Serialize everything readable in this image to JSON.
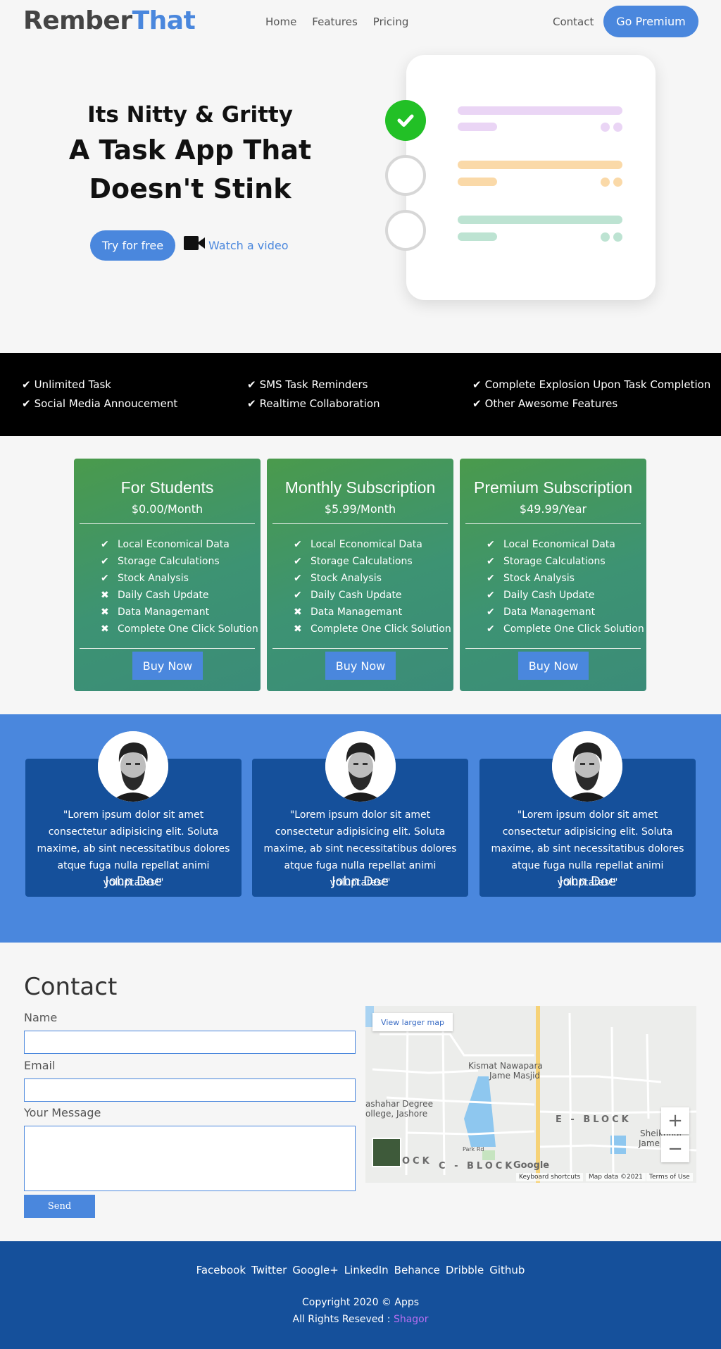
{
  "brand": {
    "part1": "Rember",
    "part2": "That",
    "accent": "#4a87dd"
  },
  "nav": {
    "links": [
      "Home",
      "Features",
      "Pricing"
    ],
    "contact": "Contact",
    "premium_button": "Go Premium"
  },
  "hero": {
    "subtitle": "Its Nitty & Gritty",
    "title_line1": "A Task App That",
    "title_line2": "Doesn't Stink",
    "try_button": "Try for free",
    "watch_link": "Watch a video"
  },
  "features": [
    "Unlimited Task",
    "SMS Task Reminders",
    "Complete Explosion Upon Task Completion",
    "Social Media Annoucement",
    "Realtime Collaboration",
    "Other Awesome Features"
  ],
  "pricing": {
    "buy_label": "Buy Now",
    "plans": [
      {
        "name": "For Students",
        "price": "$0.00/Month",
        "items": [
          {
            "label": "Local Economical Data",
            "included": true
          },
          {
            "label": "Storage Calculations",
            "included": true
          },
          {
            "label": "Stock Analysis",
            "included": true
          },
          {
            "label": "Daily Cash Update",
            "included": false
          },
          {
            "label": "Data Managemant",
            "included": false
          },
          {
            "label": "Complete One Click Solution",
            "included": false
          }
        ]
      },
      {
        "name": "Monthly Subscription",
        "price": "$5.99/Month",
        "items": [
          {
            "label": "Local Economical Data",
            "included": true
          },
          {
            "label": "Storage Calculations",
            "included": true
          },
          {
            "label": "Stock Analysis",
            "included": true
          },
          {
            "label": "Daily Cash Update",
            "included": true
          },
          {
            "label": "Data Managemant",
            "included": false
          },
          {
            "label": "Complete One Click Solution",
            "included": false
          }
        ]
      },
      {
        "name": "Premium Subscription",
        "price": "$49.99/Year",
        "items": [
          {
            "label": "Local Economical Data",
            "included": true
          },
          {
            "label": "Storage Calculations",
            "included": true
          },
          {
            "label": "Stock Analysis",
            "included": true
          },
          {
            "label": "Daily Cash Update",
            "included": true
          },
          {
            "label": "Data Managemant",
            "included": true
          },
          {
            "label": "Complete One Click Solution",
            "included": true
          }
        ]
      }
    ]
  },
  "testimonials": [
    {
      "quote": "\"Lorem ipsum dolor sit amet consectetur adipisicing elit. Soluta maxime, ab sint necessitatibus dolores atque fuga nulla repellat animi voluptates!\"",
      "name": "John Doe"
    },
    {
      "quote": "\"Lorem ipsum dolor sit amet consectetur adipisicing elit. Soluta maxime, ab sint necessitatibus dolores atque fuga nulla repellat animi voluptates!\"",
      "name": "John Doe"
    },
    {
      "quote": "\"Lorem ipsum dolor sit amet consectetur adipisicing elit. Soluta maxime, ab sint necessitatibus dolores atque fuga nulla repellat animi voluptates!\"",
      "name": "John Doe"
    }
  ],
  "contact": {
    "title": "Contact",
    "name_label": "Name",
    "email_label": "Email",
    "message_label": "Your Message",
    "send_button": "Send"
  },
  "map": {
    "view_larger": "View larger map",
    "labels": {
      "kismat": "Kismat Nawapara",
      "jame": "Jame Masjid",
      "degree1": "ashahar Degree",
      "degree2": "ollege, Jashore",
      "e_block": "E - BLOCK",
      "c_block": "C - BLOCK",
      "ock": "OCK",
      "sheikh": "Sheikhhat",
      "jame2": "Jame M",
      "park": "Park Rd"
    },
    "zoom_in": "+",
    "zoom_out": "−",
    "google": "Google",
    "shortcuts": "Keyboard shortcuts",
    "map_data": "Map data ©2021",
    "terms": "Terms of Use"
  },
  "footer": {
    "social": [
      "Facebook",
      "Twitter",
      "Google+",
      "LinkedIn",
      "Behance",
      "Dribble",
      "Github"
    ],
    "copyright": "Copyright 2020 © Apps",
    "rights": "All Rights Reseved : ",
    "author": "Shagor"
  }
}
